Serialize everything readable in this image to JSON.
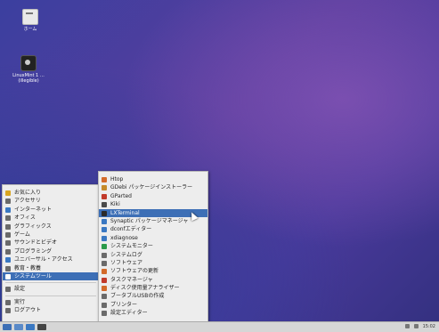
{
  "desktop": {
    "icons": [
      {
        "label": "ホーム",
        "icon": "home-folder-icon"
      },
      {
        "label": "LinuxMint 1 … (illegible)",
        "icon": "installer-disc-icon"
      }
    ]
  },
  "main_menu": {
    "items": [
      {
        "label": "お気に入り",
        "icon": "star-icon",
        "color": "#d9a520"
      },
      {
        "label": "アクセサリ",
        "icon": "accessories-icon",
        "color": "#6a6a6a"
      },
      {
        "label": "インターネット",
        "icon": "globe-icon",
        "color": "#3a78c2"
      },
      {
        "label": "オフィス",
        "icon": "office-icon",
        "color": "#6a6a6a"
      },
      {
        "label": "グラフィックス",
        "icon": "graphics-icon",
        "color": "#6a6a6a"
      },
      {
        "label": "ゲーム",
        "icon": "gamepad-icon",
        "color": "#6a6a6a"
      },
      {
        "label": "サウンドとビデオ",
        "icon": "media-icon",
        "color": "#6a6a6a"
      },
      {
        "label": "プログラミング",
        "icon": "programming-icon",
        "color": "#6a6a6a"
      },
      {
        "label": "ユニバーサル・アクセス",
        "icon": "accessibility-icon",
        "color": "#3a78c2"
      },
      {
        "label": "教育・教養",
        "icon": "education-icon",
        "color": "#6a6a6a"
      },
      {
        "label": "システムツール",
        "icon": "system-tools-icon",
        "color": "#ffffff"
      },
      {
        "label": "設定",
        "icon": "settings-icon",
        "color": "#6a6a6a"
      },
      {
        "label": "実行",
        "icon": "run-icon",
        "color": "#6a6a6a"
      },
      {
        "label": "ログアウト",
        "icon": "logout-icon",
        "color": "#6a6a6a"
      }
    ],
    "selected_index": 10
  },
  "system_tools_menu": {
    "items": [
      {
        "label": "Htop",
        "icon": "htop-icon",
        "color": "#d36a2a"
      },
      {
        "label": "GDebi パッケージインストーラー",
        "icon": "gdebi-icon",
        "color": "#c58a2a"
      },
      {
        "label": "GParted",
        "icon": "gparted-icon",
        "color": "#c23a2a"
      },
      {
        "label": "Kiki",
        "icon": "kiki-icon",
        "color": "#4a4a4a"
      },
      {
        "label": "LXTerminal",
        "icon": "terminal-icon",
        "color": "#2b2b2b"
      },
      {
        "label": "Synaptic パッケージマネージャ",
        "icon": "synaptic-icon",
        "color": "#3a78c2"
      },
      {
        "label": "dconfエディター",
        "icon": "dconf-icon",
        "color": "#3a78c2"
      },
      {
        "label": "xdiagnose",
        "icon": "diagnose-icon",
        "color": "#3a78c2"
      },
      {
        "label": "システムモニター",
        "icon": "monitor-icon",
        "color": "#2a9a4a"
      },
      {
        "label": "システムログ",
        "icon": "log-icon",
        "color": "#6a6a6a"
      },
      {
        "label": "ソフトウェア",
        "icon": "software-icon",
        "color": "#6a6a6a"
      },
      {
        "label": "ソフトウェアの更新",
        "icon": "update-icon",
        "color": "#d36a2a"
      },
      {
        "label": "タスクマネージャ",
        "icon": "task-manager-icon",
        "color": "#c23a2a"
      },
      {
        "label": "ディスク使用量アナライザー",
        "icon": "disk-usage-icon",
        "color": "#d36a2a"
      },
      {
        "label": "ブータブルUSBの作成",
        "icon": "usb-icon",
        "color": "#6a6a6a"
      },
      {
        "label": "プリンター",
        "icon": "printer-icon",
        "color": "#6a6a6a"
      },
      {
        "label": "設定エディター",
        "icon": "config-editor-icon",
        "color": "#6a6a6a"
      }
    ],
    "hovered_index": 4
  },
  "taskbar": {
    "buttons": [
      {
        "icon": "start-menu-icon",
        "color": "#3d6fb6"
      },
      {
        "icon": "file-manager-icon",
        "color": "#5a8ac8"
      },
      {
        "icon": "browser-icon",
        "color": "#3a78c2"
      },
      {
        "icon": "terminal-icon",
        "color": "#444444"
      }
    ],
    "clock": "15:02"
  }
}
